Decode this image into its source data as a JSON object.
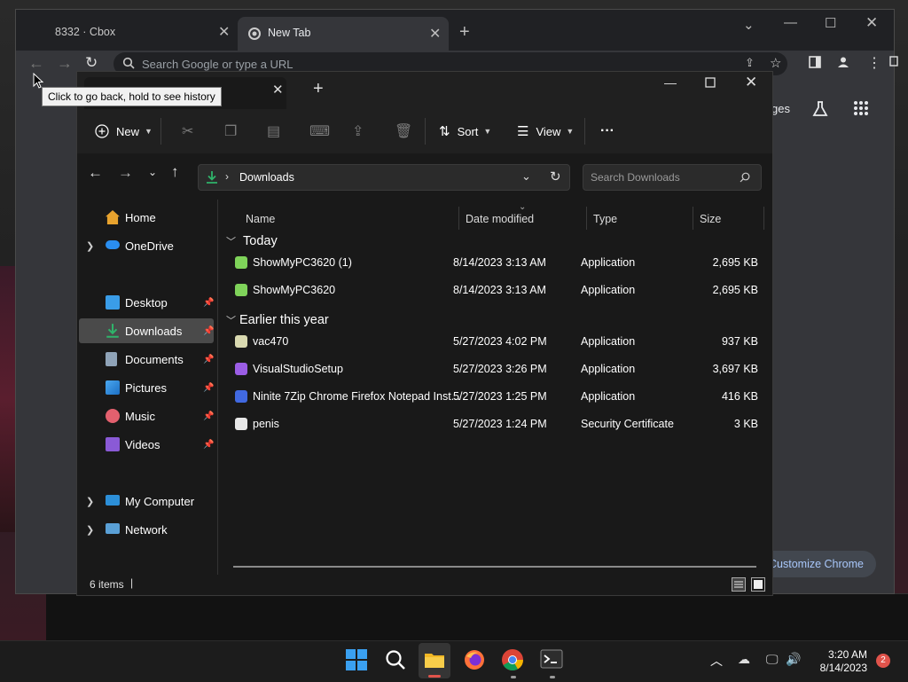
{
  "chrome": {
    "tabs": [
      {
        "label": "8332 · Cbox"
      },
      {
        "label": "New Tab"
      }
    ],
    "omnibox_placeholder": "Search Google or type a URL",
    "back_tooltip": "Click to go back, hold to see history",
    "images_link_fragment": "ges",
    "customize_label": "Customize Chrome"
  },
  "explorer": {
    "toolbar": {
      "new_label": "New",
      "sort_label": "Sort",
      "view_label": "View",
      "more_label": "···"
    },
    "address": {
      "location": "Downloads",
      "search_placeholder": "Search Downloads"
    },
    "sidebar": {
      "items": [
        {
          "label": "Home",
          "icon": "home-icon",
          "pinned": false
        },
        {
          "label": "OneDrive",
          "icon": "cloud-icon",
          "pinned": false
        },
        {
          "label": "Desktop",
          "icon": "desktop-icon",
          "pinned": true
        },
        {
          "label": "Downloads",
          "icon": "download-icon",
          "pinned": true,
          "selected": true
        },
        {
          "label": "Documents",
          "icon": "document-icon",
          "pinned": true
        },
        {
          "label": "Pictures",
          "icon": "picture-icon",
          "pinned": true
        },
        {
          "label": "Music",
          "icon": "music-icon",
          "pinned": true
        },
        {
          "label": "Videos",
          "icon": "video-icon",
          "pinned": true
        },
        {
          "label": "My Computer",
          "icon": "computer-icon",
          "pinned": false
        },
        {
          "label": "Network",
          "icon": "network-icon",
          "pinned": false
        }
      ]
    },
    "columns": [
      "Name",
      "Date modified",
      "Type",
      "Size"
    ],
    "groups": [
      {
        "label": "Today",
        "files": [
          {
            "name": "ShowMyPC3620 (1)",
            "date": "8/14/2023 3:13 AM",
            "type": "Application",
            "size": "2,695 KB"
          },
          {
            "name": "ShowMyPC3620",
            "date": "8/14/2023 3:13 AM",
            "type": "Application",
            "size": "2,695 KB"
          }
        ]
      },
      {
        "label": "Earlier this year",
        "files": [
          {
            "name": "vac470",
            "date": "5/27/2023 4:02 PM",
            "type": "Application",
            "size": "937 KB"
          },
          {
            "name": "VisualStudioSetup",
            "date": "5/27/2023 3:26 PM",
            "type": "Application",
            "size": "3,697 KB"
          },
          {
            "name": "Ninite 7Zip Chrome Firefox Notepad Inst...",
            "date": "5/27/2023 1:25 PM",
            "type": "Application",
            "size": "416 KB"
          },
          {
            "name": "penis",
            "date": "5/27/2023 1:24 PM",
            "type": "Security Certificate",
            "size": "3 KB"
          }
        ]
      }
    ],
    "status": "6 items"
  },
  "taskbar": {
    "time": "3:20 AM",
    "date": "8/14/2023",
    "notification_count": "2"
  },
  "colors": {
    "accent_green": "#2fb36a",
    "selected_nav": "#4a4a4a",
    "link_blue": "#a8c7fa"
  }
}
